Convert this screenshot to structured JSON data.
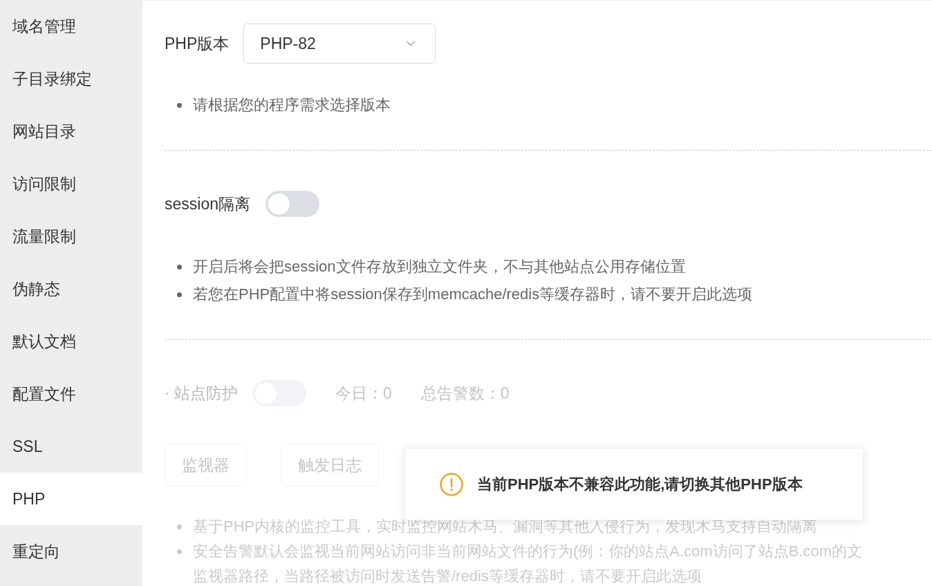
{
  "sidebar": {
    "items": [
      {
        "label": "域名管理",
        "selected": false
      },
      {
        "label": "子目录绑定",
        "selected": false
      },
      {
        "label": "网站目录",
        "selected": false
      },
      {
        "label": "访问限制",
        "selected": false
      },
      {
        "label": "流量限制",
        "selected": false
      },
      {
        "label": "伪静态",
        "selected": false
      },
      {
        "label": "默认文档",
        "selected": false
      },
      {
        "label": "配置文件",
        "selected": false
      },
      {
        "label": "SSL",
        "selected": false
      },
      {
        "label": "PHP",
        "selected": true
      },
      {
        "label": "重定向",
        "selected": false
      }
    ]
  },
  "php_version": {
    "label": "PHP版本",
    "value": "PHP-82",
    "notes": [
      {
        "kind": "bullet",
        "text": "请根据您的程序需求选择版本"
      }
    ]
  },
  "session_isolation": {
    "label": "session隔离",
    "on": false,
    "notes": [
      {
        "kind": "bullet",
        "text": "开启后将会把session文件存放到独立文件夹，不与其他站点公用存储位置"
      },
      {
        "kind": "bullet",
        "text": "若您在PHP配置中将session保存到memcache/redis等缓存器时，请不要开启此选项"
      }
    ]
  },
  "site_protection": {
    "disabled": true,
    "label": "站点防护",
    "on": false,
    "stats": [
      "今日：0",
      "总告警数：0"
    ],
    "buttons": [
      "监视器",
      "触发日志"
    ],
    "notes": [
      {
        "kind": "bullet",
        "text": "基于PHP内核的监控工具，实时监控网站木马、漏洞等其他入侵行为，发现木马支持自动隔离"
      },
      {
        "kind": "bullet",
        "text": "安全告警默认会监视当前网站访问非当前网站文件的行为(例：你的站点A.com访问了站点B.com的文"
      },
      {
        "kind": "continuation",
        "text": "监视器路径，当路径被访问时发送告警/redis等缓存器时，请不要开启此选项"
      }
    ]
  },
  "toast": {
    "kind": "warning",
    "message": "当前PHP版本不兼容此功能,请切换其他PHP版本"
  }
}
